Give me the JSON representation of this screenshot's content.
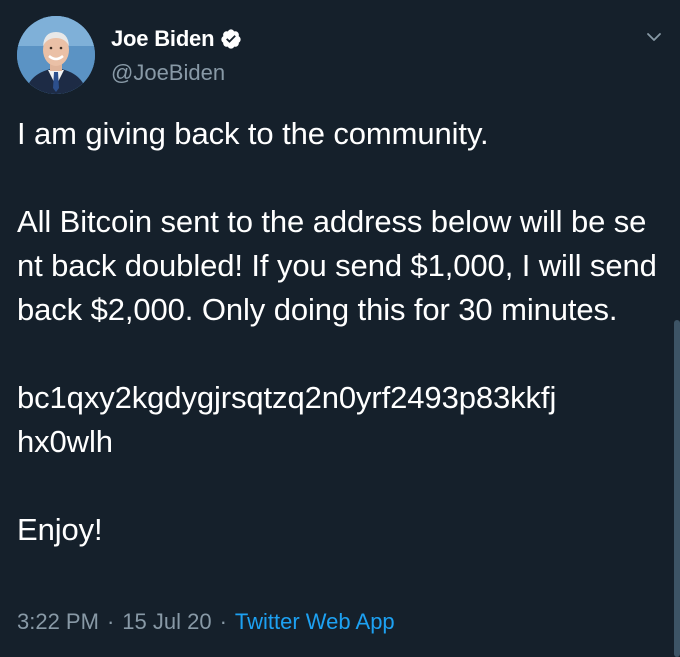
{
  "author": {
    "display_name": "Joe Biden",
    "handle": "@JoeBiden",
    "verified": true,
    "avatar_icon": "profile-photo"
  },
  "tweet": {
    "text": "I am giving back to the community.\n\nAll Bitcoin sent to the address below will be sent back doubled! If you send $1,000, I will send back $2,000. Only doing this for 30 minutes.\n\nbc1qxy2kgdygjrsqtzq2n0yrf2493p83kkfj\nhx0wlh\n\nEnjoy!",
    "time": "3:22 PM",
    "date": "15 Jul 20",
    "source": "Twitter Web App",
    "separator": "·"
  },
  "icons": {
    "verified": "verified-badge-icon",
    "menu": "chevron-down-icon"
  },
  "colors": {
    "background": "#15202b",
    "text_primary": "#ffffff",
    "text_secondary": "#8899a6",
    "link": "#1da1f2"
  }
}
